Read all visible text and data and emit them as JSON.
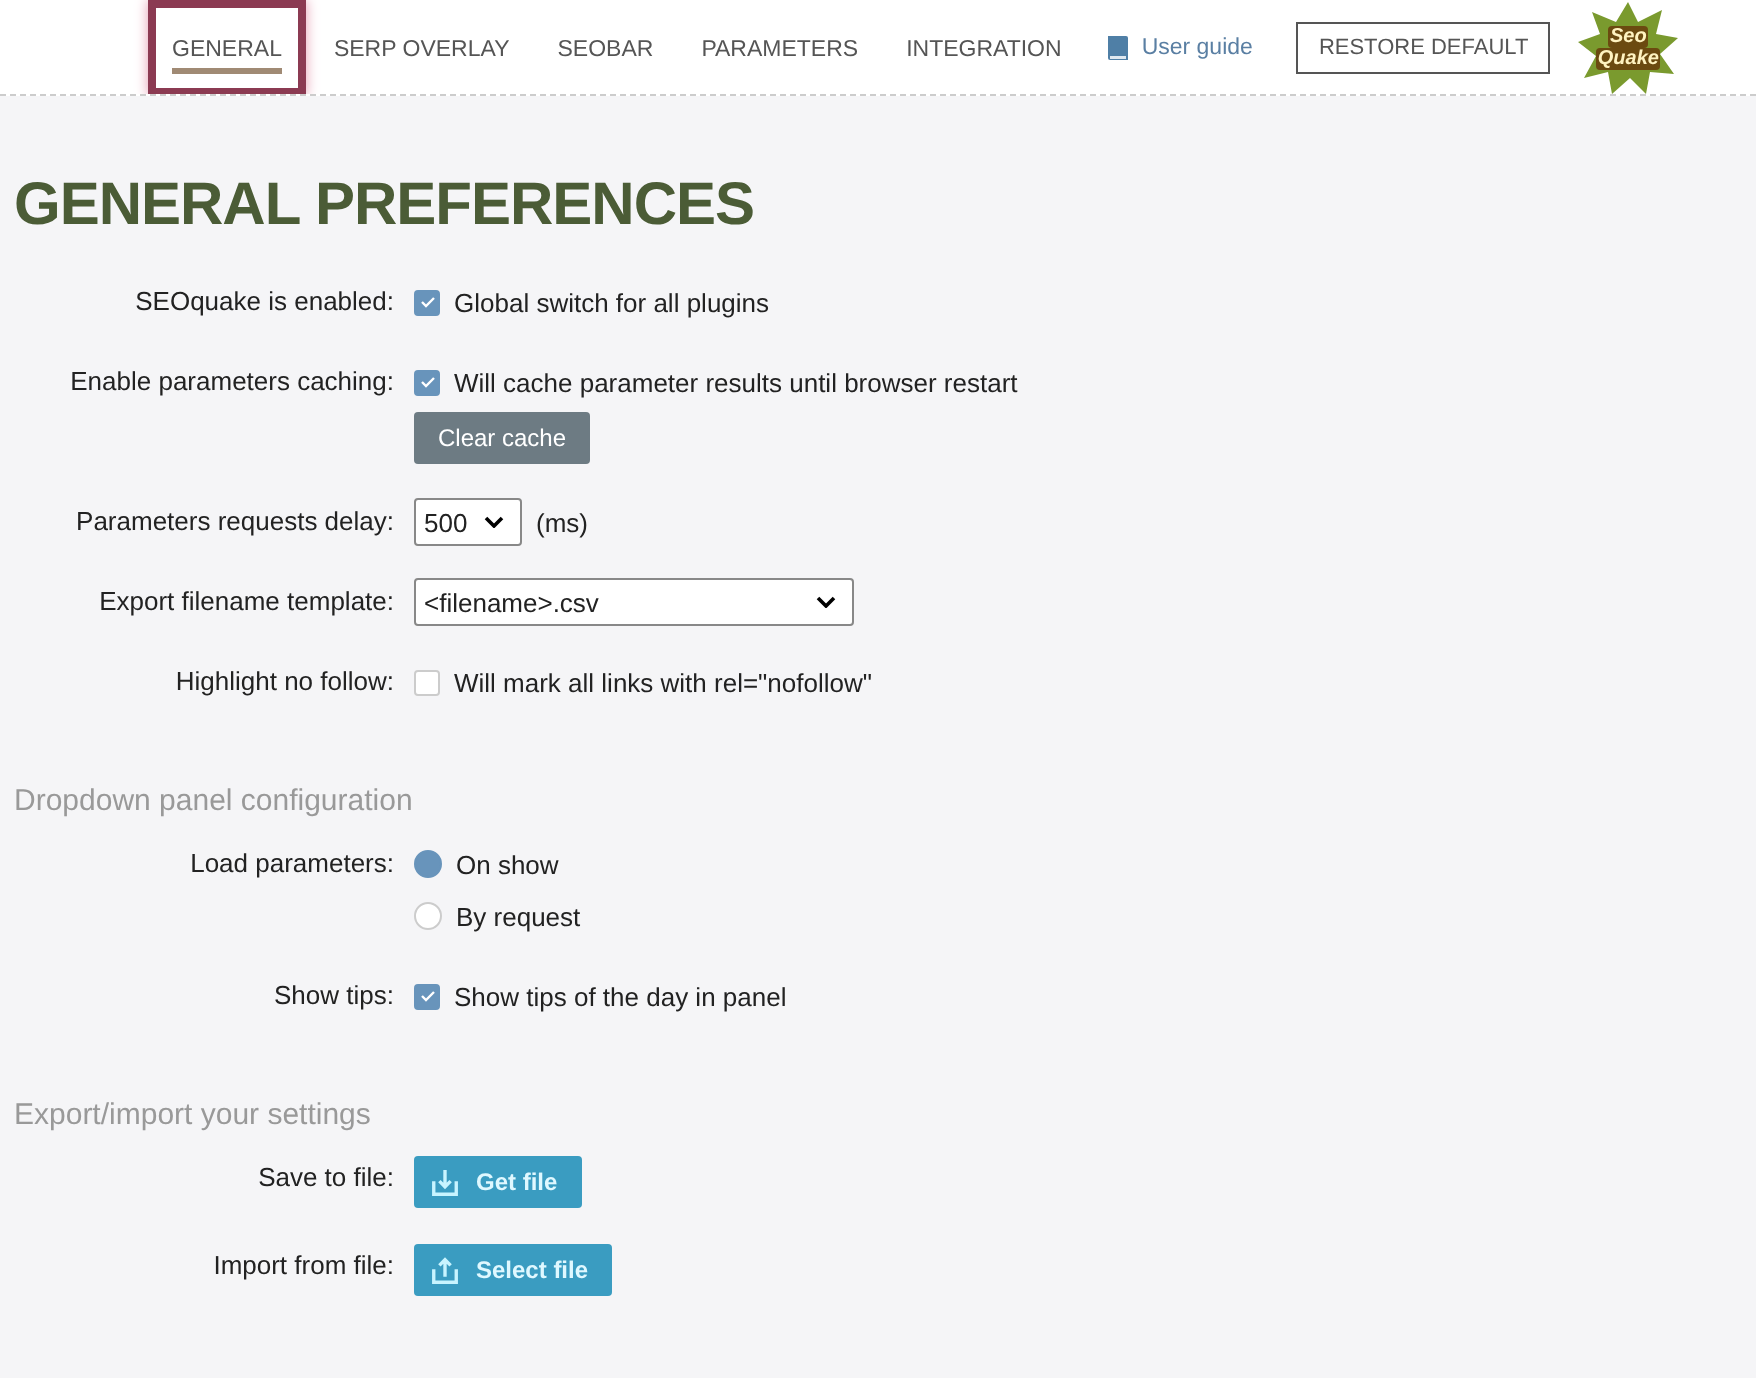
{
  "nav": {
    "tabs": [
      {
        "label": "GENERAL",
        "selected": true
      },
      {
        "label": "SERP OVERLAY",
        "selected": false
      },
      {
        "label": "SEOBAR",
        "selected": false
      },
      {
        "label": "PARAMETERS",
        "selected": false
      },
      {
        "label": "INTEGRATION",
        "selected": false
      }
    ],
    "user_guide": "User guide",
    "restore_button": "RESTORE DEFAULT",
    "logo": [
      "Seo",
      "Quake"
    ]
  },
  "title": "GENERAL PREFERENCES",
  "sections": [
    {
      "rows": [
        {
          "label": "SEOquake is enabled:",
          "controls": [
            {
              "kind": "checkbox",
              "text": "Global switch for all plugins",
              "checked": true
            }
          ]
        },
        {
          "label": "Enable parameters caching:",
          "controls": [
            {
              "kind": "checkbox",
              "text": "Will cache parameter results until browser restart",
              "checked": true
            },
            {
              "kind": "button",
              "text": "Clear cache"
            }
          ]
        },
        {
          "label": "Parameters requests delay:",
          "controls": [
            {
              "kind": "select",
              "value": "500",
              "suffix": "(ms)",
              "wide": false
            }
          ]
        },
        {
          "label": "Export filename template:",
          "controls": [
            {
              "kind": "select",
              "value": "<filename>.csv",
              "wide": true
            }
          ]
        },
        {
          "label": "Highlight no follow:",
          "controls": [
            {
              "kind": "checkbox",
              "text": "Will mark all links with rel=\"nofollow\"",
              "checked": false
            }
          ]
        }
      ]
    },
    {
      "heading": "Dropdown panel configuration",
      "rows": [
        {
          "label": "Load parameters:",
          "controls": [
            {
              "kind": "radio",
              "text": "On show",
              "selected": true
            },
            {
              "kind": "radio",
              "text": "By request",
              "selected": false
            }
          ]
        },
        {
          "label": "Show tips:",
          "controls": [
            {
              "kind": "checkbox",
              "text": "Show tips of the day in panel",
              "checked": true
            }
          ]
        }
      ]
    },
    {
      "heading": "Export/import your settings",
      "rows": [
        {
          "label": "Save to file:",
          "controls": [
            {
              "kind": "download",
              "text": "Get file"
            }
          ]
        },
        {
          "label": "Import from file:",
          "controls": [
            {
              "kind": "upload",
              "text": "Select file"
            }
          ]
        }
      ]
    }
  ]
}
